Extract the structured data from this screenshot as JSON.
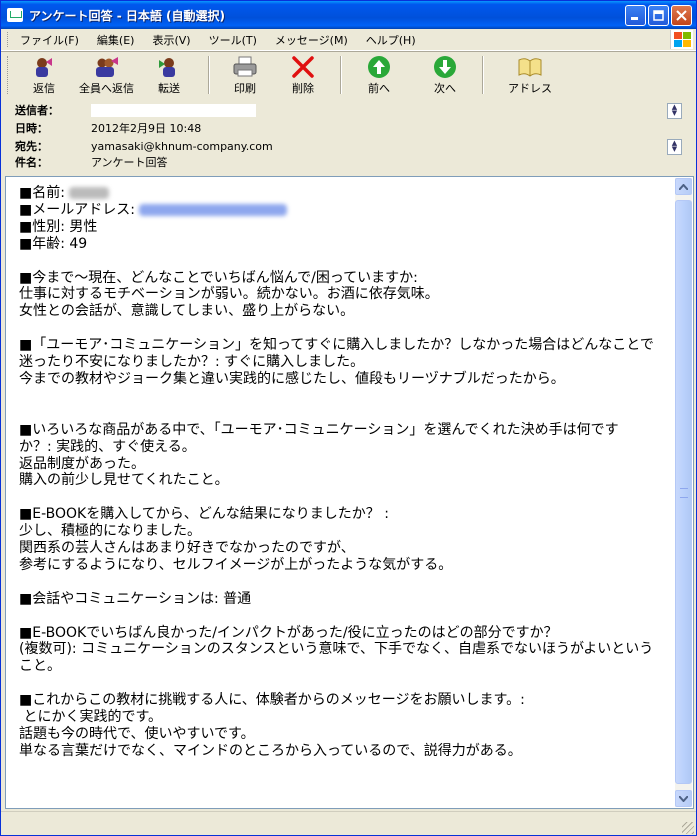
{
  "window": {
    "title": "アンケート回答 - 日本語 (自動選択)"
  },
  "menu": [
    "ファイル(F)",
    "編集(E)",
    "表示(V)",
    "ツール(T)",
    "メッセージ(M)",
    "ヘルプ(H)"
  ],
  "toolbar": {
    "reply": "返信",
    "reply_all": "全員へ返信",
    "forward": "転送",
    "print": "印刷",
    "delete": "削除",
    "prev": "前へ",
    "next": "次へ",
    "address": "アドレス"
  },
  "header": {
    "from_label": "送信者：",
    "date_label": "日時：",
    "date_value": "2012年2月9日 10:48",
    "to_label": "宛先：",
    "to_value": "yamasaki@khnum-company.com",
    "subject_label": "件名：",
    "subject_value": "アンケート回答"
  },
  "body": {
    "name_label": "■名前: ",
    "email_label": "■メールアドレス: ",
    "lines_after_email": "■性別: 男性\n■年齢: 49\n\n■今まで～現在、どんなことでいちばん悩んで/困っていますか:\n仕事に対するモチベーションが弱い。続かない。お酒に依存気味。\n女性との会話が、意識してしまい、盛り上がらない。\n\n■「ユーモア･コミュニケーション」を知ってすぐに購入しましたか？しなかった場合はどんなことで\n迷ったり不安になりましたか？: すぐに購入しました。\n今までの教材やジョーク集と違い実践的に感じたし、値段もリーヅナブルだったから。\n\n\n■いろいろな商品がある中で、「ユーモア･コミュニケーション」を選んでくれた決め手は何です\nか？: 実践的、すぐ使える。\n返品制度があった。\n購入の前少し見せてくれたこと。\n\n■E-BOOKを購入してから、どんな結果になりましたか？ :\n少し、積極的になりました。\n関西系の芸人さんはあまり好きでなかったのですが、\n参考にするようになり、セルフイメージが上がったような気がする。\n\n■会話やコミュニケーションは: 普通\n\n■E-BOOKでいちばん良かった/インパクトがあった/役に立ったのはどの部分ですか？\n(複数可): コミュニケーションのスタンスという意味で、下手でなく、自虐系でないほうがよいという\nこと。\n\n■これからこの教材に挑戦する人に、体験者からのメッセージをお願いします。:\n とにかく実践的です。\n話題も今の時代で、使いやすいです。\n単なる言葉だけでなく、マインドのところから入っているので、説得力がある。"
  }
}
